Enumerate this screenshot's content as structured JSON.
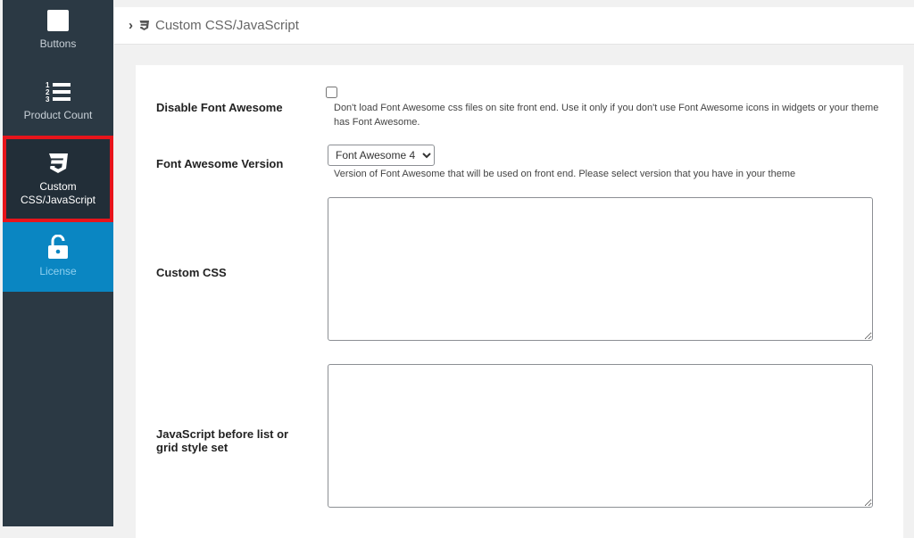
{
  "sidebar": {
    "items": [
      {
        "label": "Buttons",
        "icon": "square-icon"
      },
      {
        "label": "Product Count",
        "icon": "list-ol-icon"
      },
      {
        "label": "Custom CSS/JavaScript",
        "icon": "css3-icon",
        "active": true
      },
      {
        "label": "License",
        "icon": "unlock-icon"
      }
    ]
  },
  "header": {
    "breadcrumb": "Custom CSS/JavaScript"
  },
  "form": {
    "disable_fa": {
      "label": "Disable Font Awesome",
      "checked": false,
      "description": "Don't load Font Awesome css files on site front end. Use it only if you don't use Font Awesome icons in widgets or your theme has Font Awesome."
    },
    "fa_version": {
      "label": "Font Awesome Version",
      "value": "Font Awesome 4",
      "description": "Version of Font Awesome that will be used on front end. Please select version that you have in your theme"
    },
    "custom_css": {
      "label": "Custom CSS",
      "value": ""
    },
    "js_before": {
      "label": "JavaScript before list or grid style set",
      "value": ""
    }
  },
  "colors": {
    "sidebar": "#2b3944",
    "active_outline": "#e8141b",
    "license": "#0a86c2"
  }
}
